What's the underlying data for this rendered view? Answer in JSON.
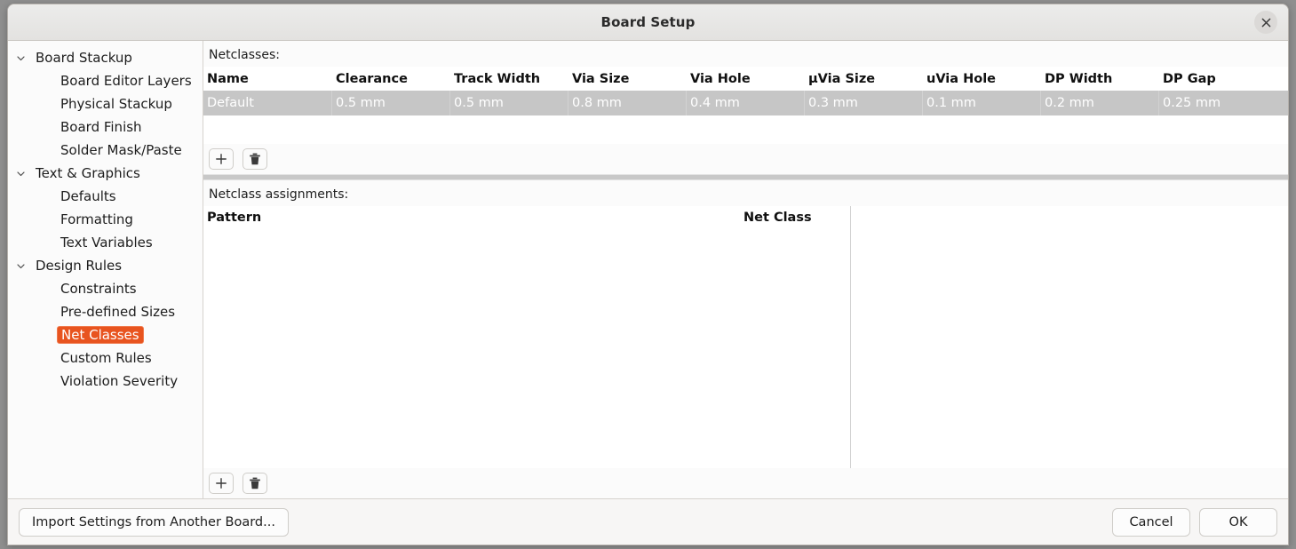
{
  "window": {
    "title": "Board Setup",
    "close_icon": "close-icon"
  },
  "sidebar": {
    "items": [
      {
        "label": "Board Stackup",
        "level": 0,
        "expanded": true,
        "selected": false
      },
      {
        "label": "Board Editor Layers",
        "level": 1,
        "expanded": null,
        "selected": false
      },
      {
        "label": "Physical Stackup",
        "level": 1,
        "expanded": null,
        "selected": false
      },
      {
        "label": "Board Finish",
        "level": 1,
        "expanded": null,
        "selected": false
      },
      {
        "label": "Solder Mask/Paste",
        "level": 1,
        "expanded": null,
        "selected": false
      },
      {
        "label": "Text & Graphics",
        "level": 0,
        "expanded": true,
        "selected": false
      },
      {
        "label": "Defaults",
        "level": 1,
        "expanded": null,
        "selected": false
      },
      {
        "label": "Formatting",
        "level": 1,
        "expanded": null,
        "selected": false
      },
      {
        "label": "Text Variables",
        "level": 1,
        "expanded": null,
        "selected": false
      },
      {
        "label": "Design Rules",
        "level": 0,
        "expanded": true,
        "selected": false
      },
      {
        "label": "Constraints",
        "level": 1,
        "expanded": null,
        "selected": false
      },
      {
        "label": "Pre-defined Sizes",
        "level": 1,
        "expanded": null,
        "selected": false
      },
      {
        "label": "Net Classes",
        "level": 1,
        "expanded": null,
        "selected": true
      },
      {
        "label": "Custom Rules",
        "level": 1,
        "expanded": null,
        "selected": false
      },
      {
        "label": "Violation Severity",
        "level": 1,
        "expanded": null,
        "selected": false
      }
    ],
    "selected_color": "#e8541f",
    "selected_text_color": "#ffffff"
  },
  "netclasses": {
    "panel_label": "Netclasses:",
    "columns": [
      "Name",
      "Clearance",
      "Track Width",
      "Via Size",
      "Via Hole",
      "µVia Size",
      "uVia Hole",
      "DP Width",
      "DP Gap"
    ],
    "rows": [
      {
        "selected": true,
        "cells": [
          "Default",
          "0.5 mm",
          "0.5 mm",
          "0.8 mm",
          "0.4 mm",
          "0.3 mm",
          "0.1 mm",
          "0.2 mm",
          "0.25 mm"
        ]
      }
    ],
    "add_button": {
      "name": "add-netclass-button",
      "icon": "plus-icon"
    },
    "delete_button": {
      "name": "delete-netclass-button",
      "icon": "trash-icon"
    }
  },
  "assignments": {
    "panel_label": "Netclass assignments:",
    "columns": [
      "Pattern",
      "Net Class"
    ],
    "rows": [],
    "add_button": {
      "name": "add-assignment-button",
      "icon": "plus-icon"
    },
    "delete_button": {
      "name": "delete-assignment-button",
      "icon": "trash-icon"
    }
  },
  "footer": {
    "import_label": "Import Settings from Another Board...",
    "cancel_label": "Cancel",
    "ok_label": "OK"
  }
}
